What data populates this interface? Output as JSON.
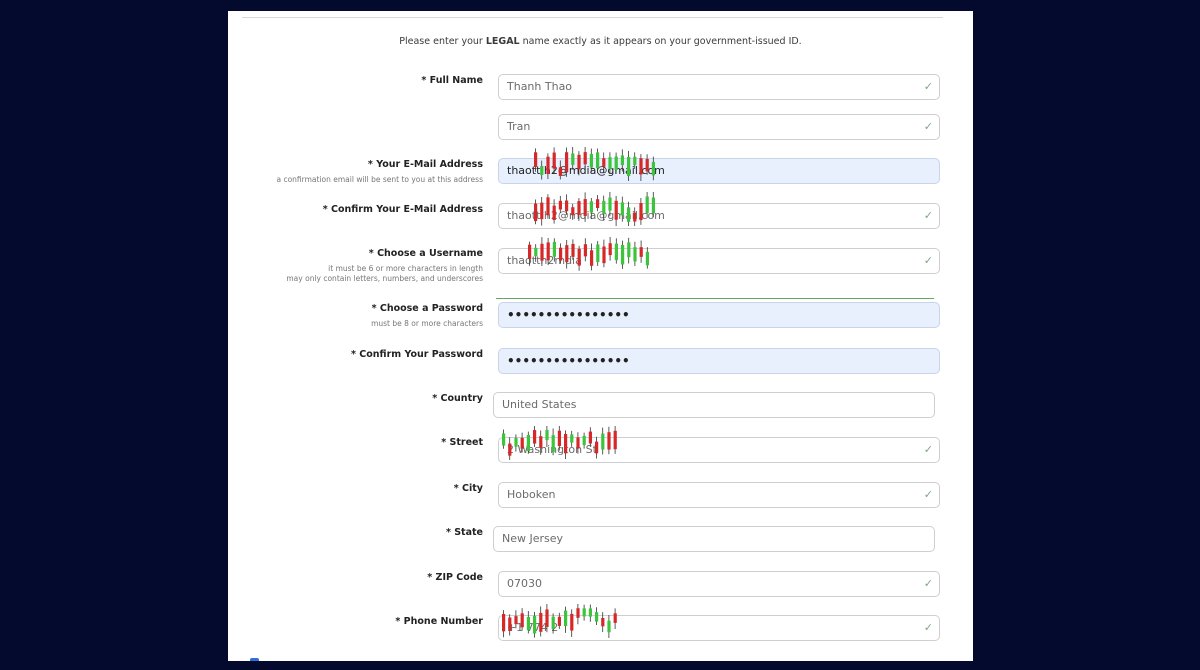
{
  "intro": {
    "before": "Please enter your ",
    "bold": "LEGAL",
    "after": " name exactly as it appears on your government-issued ID."
  },
  "fields": {
    "full_name": {
      "label": "* Full Name",
      "first": "Thanh Thao",
      "last": "Tran"
    },
    "email": {
      "label": "* Your E-Mail Address",
      "hint": "a confirmation email will be sent to you at this address",
      "value": "thaott.h2@mdia@gmail.com"
    },
    "confirm_email": {
      "label": "* Confirm Your E-Mail Address",
      "value": "thaott.h2@mdia@gmail.com"
    },
    "username": {
      "label": "* Choose a Username",
      "hint1": "it must be 6 or more characters in length",
      "hint2": "may only contain letters, numbers, and underscores",
      "value": "thaotth2mdia"
    },
    "password": {
      "label": "* Choose a Password",
      "hint": "must be 8 or more characters",
      "value": "••••••••••••••••"
    },
    "confirm_password": {
      "label": "* Confirm Your Password",
      "value": "••••••••••••••••"
    },
    "country": {
      "label": "* Country",
      "value": "United States"
    },
    "street": {
      "label": "* Street",
      "value": "2 Washington St"
    },
    "city": {
      "label": "* City",
      "value": "Hoboken"
    },
    "state": {
      "label": "* State",
      "value": "New Jersey"
    },
    "zip": {
      "label": "* ZIP Code",
      "value": "07030"
    },
    "phone": {
      "label": "* Phone Number",
      "value": "+1 774 2"
    }
  },
  "colors": {
    "background": "#030a2e",
    "autofill": "#e8f0fe",
    "check": "#7ea87e",
    "candle_red": "#d62828",
    "candle_green": "#3cc43c"
  }
}
